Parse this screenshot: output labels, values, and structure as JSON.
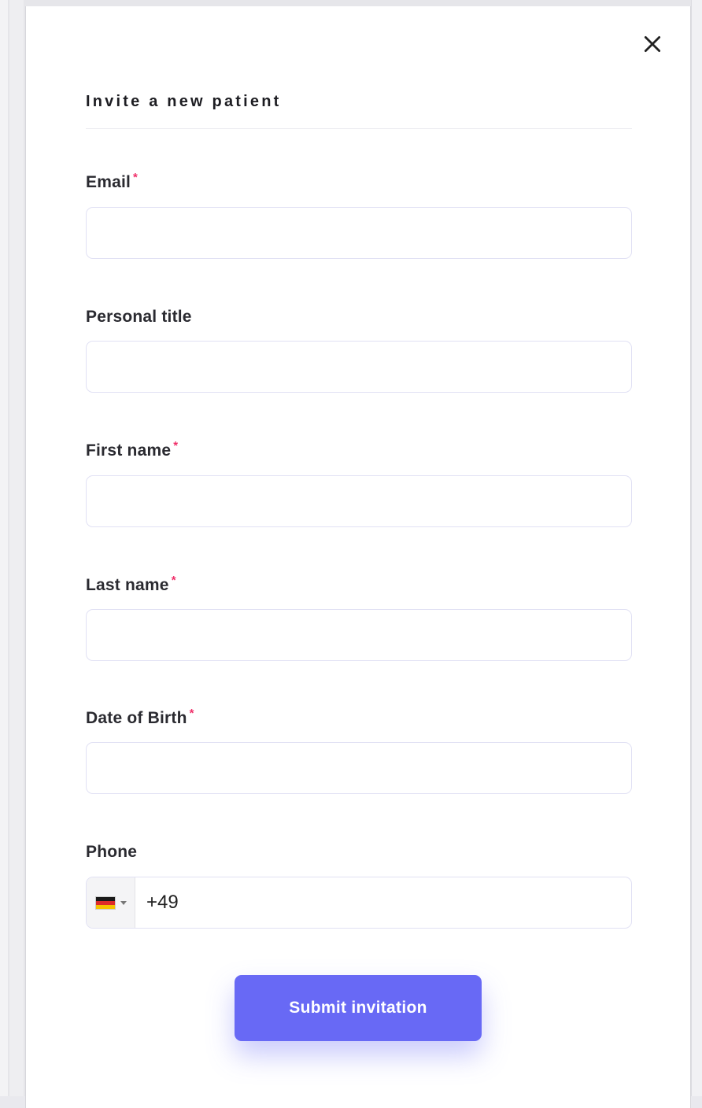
{
  "modal": {
    "title": "Invite a new patient",
    "close_icon": "close-icon",
    "required_marker": "*"
  },
  "fields": {
    "email": {
      "label": "Email",
      "required": true,
      "value": ""
    },
    "personal_title": {
      "label": "Personal title",
      "required": false,
      "value": ""
    },
    "first_name": {
      "label": "First name",
      "required": true,
      "value": ""
    },
    "last_name": {
      "label": "Last name",
      "required": true,
      "value": ""
    },
    "date_of_birth": {
      "label": "Date of Birth",
      "required": true,
      "value": ""
    },
    "phone": {
      "label": "Phone",
      "required": false,
      "value": "+49",
      "country_flag": "germany-flag-icon"
    }
  },
  "submit": {
    "label": "Submit invitation"
  },
  "colors": {
    "accent": "#6869f5",
    "required": "#f0306a",
    "input_border": "#e1e1f4"
  }
}
